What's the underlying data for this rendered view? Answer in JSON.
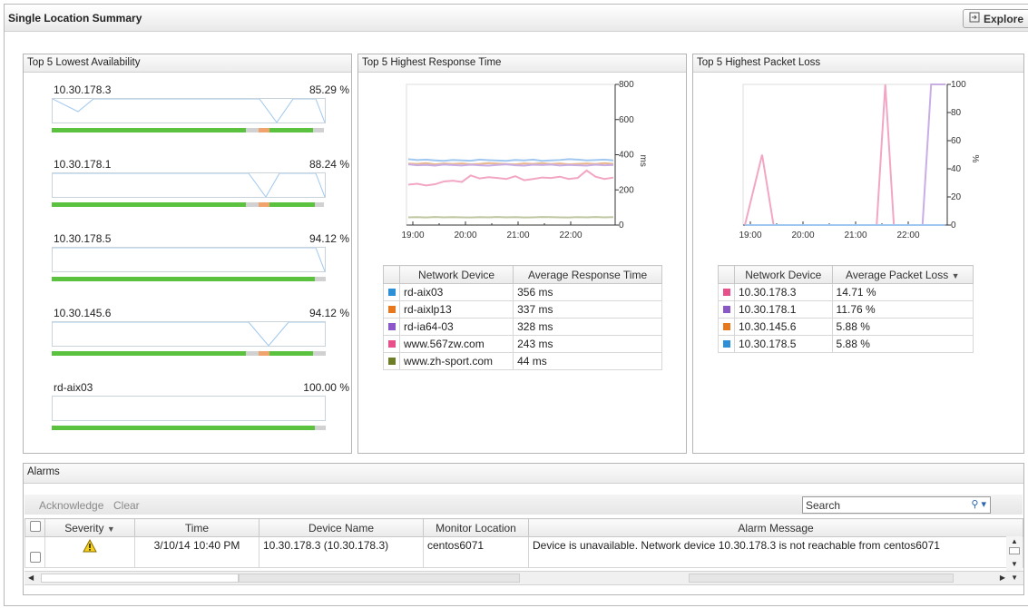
{
  "header": {
    "title": "Single Location Summary",
    "explore_label": "Explore"
  },
  "availability": {
    "title": "Top 5 Lowest Availability",
    "items": [
      {
        "name": "10.30.178.3",
        "pct": "85.29 %"
      },
      {
        "name": "10.30.178.1",
        "pct": "88.24 %"
      },
      {
        "name": "10.30.178.5",
        "pct": "94.12 %"
      },
      {
        "name": "10.30.145.6",
        "pct": "94.12 %"
      },
      {
        "name": "rd-aix03",
        "pct": "100.00 %"
      }
    ]
  },
  "response": {
    "title": "Top 5 Highest Response Time",
    "col1": "Network Device",
    "col2": "Average Response Time",
    "rows": [
      {
        "device": "rd-aix03",
        "value": "356 ms",
        "color": "#2e8fd9"
      },
      {
        "device": "rd-aixlp13",
        "value": "337 ms",
        "color": "#e8781e"
      },
      {
        "device": "rd-ia64-03",
        "value": "328 ms",
        "color": "#8a58c7"
      },
      {
        "device": "www.567zw.com",
        "value": "243 ms",
        "color": "#e8508c"
      },
      {
        "device": "www.zh-sport.com",
        "value": "44 ms",
        "color": "#6d7d28"
      }
    ]
  },
  "packet": {
    "title": "Top 5 Highest Packet Loss",
    "col1": "Network Device",
    "col2": "Average Packet Loss",
    "rows": [
      {
        "device": "10.30.178.3",
        "value": "14.71 %",
        "color": "#e8508c"
      },
      {
        "device": "10.30.178.1",
        "value": "11.76 %",
        "color": "#8a58c7"
      },
      {
        "device": "10.30.145.6",
        "value": "5.88 %",
        "color": "#e8781e"
      },
      {
        "device": "10.30.178.5",
        "value": "5.88 %",
        "color": "#2e8fd9"
      }
    ]
  },
  "chart_data": [
    {
      "type": "line",
      "x_ticks": [
        "19:00",
        "20:00",
        "21:00",
        "22:00"
      ],
      "y_ticks": [
        "0",
        "200",
        "400",
        "600",
        "800"
      ],
      "ylabel": "ms",
      "ylim": [
        0,
        800
      ],
      "series": [
        {
          "name": "rd-aix03",
          "color": "#9fc7ef",
          "values": [
            375,
            370,
            372,
            368,
            365,
            370,
            368,
            366,
            372,
            369,
            367,
            365,
            370,
            368,
            372,
            365,
            368,
            370,
            375,
            372,
            368,
            370,
            372,
            368
          ]
        },
        {
          "name": "rd-aixlp13",
          "color": "#e9b78d",
          "values": [
            350,
            348,
            352,
            345,
            350,
            347,
            350,
            346,
            348,
            352,
            350,
            347,
            345,
            350,
            348,
            352,
            347,
            350,
            345,
            348,
            350,
            347,
            352,
            348
          ]
        },
        {
          "name": "rd-ia64-03",
          "color": "#c9aee6",
          "values": [
            345,
            340,
            342,
            338,
            344,
            341,
            339,
            343,
            340,
            338,
            342,
            345,
            340,
            338,
            343,
            341,
            344,
            339,
            342,
            340,
            338,
            343,
            340,
            342
          ]
        },
        {
          "name": "www.567zw.com",
          "color": "#f2a6c3",
          "values": [
            230,
            235,
            225,
            232,
            248,
            252,
            245,
            282,
            265,
            272,
            268,
            262,
            278,
            255,
            262,
            270,
            268,
            275,
            262,
            268,
            310,
            275,
            262,
            270
          ]
        },
        {
          "name": "www.zh-sport.com",
          "color": "#bfc7a0",
          "values": [
            44,
            45,
            43,
            46,
            44,
            45,
            44,
            43,
            45,
            44,
            46,
            44,
            45,
            43,
            44,
            46,
            45,
            44,
            43,
            45,
            44,
            46,
            44,
            45
          ]
        }
      ]
    },
    {
      "type": "line",
      "x_ticks": [
        "19:00",
        "20:00",
        "21:00",
        "22:00"
      ],
      "y_ticks": [
        "0",
        "20",
        "40",
        "60",
        "80",
        "100"
      ],
      "ylabel": "%",
      "ylim": [
        0,
        100
      ],
      "series": [
        {
          "name": "10.30.178.3",
          "color": "#f2a6c3",
          "x": [
            0,
            0.6,
            1,
            4.6,
            4.9,
            5.2,
            7
          ],
          "values": [
            0,
            50,
            0,
            0,
            100,
            0,
            0
          ]
        },
        {
          "name": "10.30.178.1",
          "color": "#c9aee6",
          "x": [
            0,
            6.2,
            6.5,
            7
          ],
          "values": [
            0,
            0,
            100,
            100
          ]
        },
        {
          "name": "10.30.145.6",
          "color": "#e9b78d",
          "x": [
            0,
            7
          ],
          "values": [
            0,
            0
          ]
        },
        {
          "name": "10.30.178.5",
          "color": "#9fc7ef",
          "x": [
            0,
            5.2,
            5.4,
            7
          ],
          "values": [
            0,
            0,
            0,
            0
          ]
        }
      ]
    }
  ],
  "alarms": {
    "title": "Alarms",
    "acknowledge_label": "Acknowledge",
    "clear_label": "Clear",
    "search_placeholder": "Search",
    "columns": [
      "Severity",
      "Time",
      "Device Name",
      "Monitor Location",
      "Alarm Message"
    ],
    "rows": [
      {
        "time": "3/10/14 10:40 PM",
        "device": "10.30.178.3 (10.30.178.3)",
        "location": "centos6071",
        "message": "Device is unavailable. Network device 10.30.178.3 is not reachable from centos6071"
      }
    ]
  }
}
